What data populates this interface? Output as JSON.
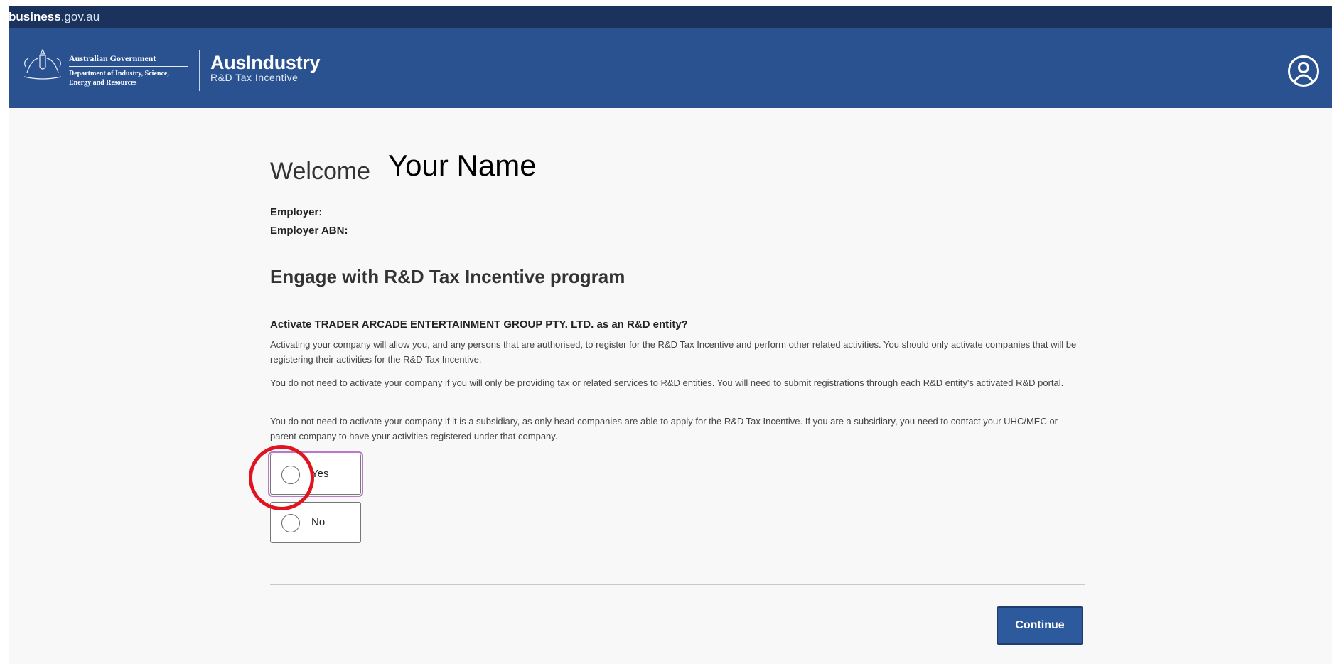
{
  "topbar": {
    "brand_bold": "business",
    "brand_rest": ".gov.au"
  },
  "header": {
    "gov_title": "Australian Government",
    "gov_dept_line1": "Department of Industry, Science,",
    "gov_dept_line2": "Energy and Resources",
    "product_name": "AusIndustry",
    "product_sub": "R&D Tax Incentive",
    "avatar_icon": "user-circle-icon"
  },
  "welcome": {
    "label": "Welcome",
    "name": "Your Name"
  },
  "meta": {
    "employer_label": "Employer:",
    "abn_label": "Employer ABN:"
  },
  "section": {
    "heading": "Engage with R&D Tax Incentive program",
    "question": "Activate TRADER ARCADE ENTERTAINMENT GROUP PTY. LTD. as an R&D entity?",
    "p1": "Activating your company will allow you, and any persons that are authorised, to register for the R&D Tax Incentive and perform other related activities. You should only activate companies that will be registering their activities for the R&D Tax Incentive.",
    "p2": "You do not need to activate your company if you will only be providing tax or related services to R&D entities. You will need to submit registrations through each R&D entity's activated R&D portal.",
    "p3": "You do not need to activate your company if it is a subsidiary, as only head companies are able to apply for the R&D Tax Incentive. If you are a subsidiary, you need to contact your UHC/MEC or parent company to have your activities registered under that company."
  },
  "options": [
    {
      "label": "Yes",
      "selected": false
    },
    {
      "label": "No",
      "selected": false
    }
  ],
  "actions": {
    "continue_label": "Continue"
  },
  "colors": {
    "topbar": "#1b335c",
    "header": "#2a5190",
    "button": "#2d5a9c",
    "highlight": "#e0141e"
  }
}
